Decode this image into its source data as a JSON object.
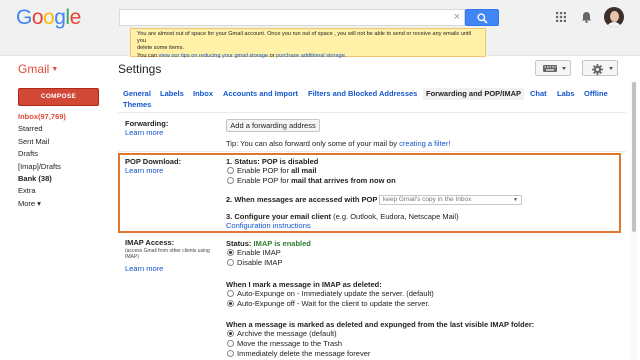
{
  "header": {
    "logo": "Google",
    "logo_colors": [
      "#4285f4",
      "#ea4335",
      "#fbbc05",
      "#4285f4",
      "#34a853",
      "#ea4335"
    ],
    "search_clear": "×",
    "icons": [
      "search-icon",
      "apps-grid-icon",
      "notifications-icon",
      "avatar"
    ]
  },
  "storage_warning": {
    "line1": "You are almost out of space for your Gmail account. Once you run out of space , you will not be able to send or receive any emails until you",
    "line2": "delete some items.",
    "line3_prefix": "You can ",
    "link1": "view our tips on reducing your gmail storage",
    "middle": " or ",
    "link2": "purchase additional storage",
    "suffix": "."
  },
  "sidebar": {
    "gmail_label": "Gmail",
    "compose": "COMPOSE",
    "items": [
      {
        "label": "Inbox(97,769)"
      },
      {
        "label": "Starred"
      },
      {
        "label": "Sent Mail"
      },
      {
        "label": "Drafts"
      },
      {
        "label": "[Imap]/Drafts"
      },
      {
        "label": "Bank (38)"
      },
      {
        "label": "Extra"
      },
      {
        "label": "More ▾"
      }
    ]
  },
  "settings": {
    "title": "Settings",
    "tabs": [
      {
        "label": "General"
      },
      {
        "label": "Labels"
      },
      {
        "label": "Inbox"
      },
      {
        "label": "Accounts and Import"
      },
      {
        "label": "Filters and Blocked Addresses"
      },
      {
        "label": "Forwarding and POP/IMAP"
      },
      {
        "label": "Chat"
      },
      {
        "label": "Labs"
      },
      {
        "label": "Offline"
      },
      {
        "label": "Themes"
      }
    ],
    "active_tab": "Forwarding and POP/IMAP",
    "forwarding": {
      "label": "Forwarding:",
      "learn_more": "Learn more",
      "button": "Add a forwarding address",
      "tip_prefix": "Tip: You can also forward only some of your mail by ",
      "tip_link": "creating a filter!"
    },
    "pop": {
      "label": "POP Download:",
      "learn_more": "Learn more",
      "status": "1. Status: POP is disabled",
      "opt1_prefix": "Enable POP for ",
      "opt1_bold": "all mail",
      "opt2_prefix": "Enable POP for ",
      "opt2_bold": "mail that arrives from now on",
      "access_label": "2. When messages are accessed with POP",
      "access_value": "keep Gmail's copy in the Inbox",
      "client_bold": "3. Configure your email client",
      "client_rest": " (e.g. Outlook, Eudora, Netscape Mail)",
      "config_link": "Configuration instructions"
    },
    "imap": {
      "label": "IMAP Access:",
      "sublabel": "(access Gmail from other clients using IMAP)",
      "learn_more": "Learn more",
      "status_prefix": "Status: ",
      "status_value": "IMAP is enabled",
      "enable": "Enable IMAP",
      "disable": "Disable IMAP",
      "deleted_heading": "When I mark a message in IMAP as deleted:",
      "expunge_on": "Auto-Expunge on - Immediately update the server. (default)",
      "expunge_off": "Auto-Expunge off - Wait for the client to update the server.",
      "expunged_heading": "When a message is marked as deleted and expunged from the last visible IMAP folder:",
      "archive": "Archive the message (default)",
      "trash": "Move the message to the Trash",
      "delete_forever": "Immediately delete the message forever"
    }
  },
  "colors": {
    "accent_red": "#dd4b39",
    "compose_bg": "#d14836",
    "link_blue": "#1155cc",
    "highlight_border": "#e0762e",
    "warning_bg": "#fff1a8",
    "imap_status_green": "#2e7d32"
  }
}
